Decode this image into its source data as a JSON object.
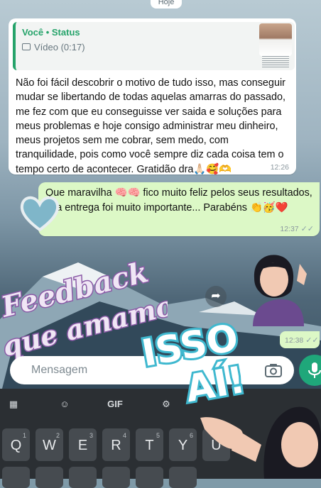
{
  "date_pill": "Hoje",
  "message_in": {
    "quote": {
      "title": "Você • Status",
      "subtitle": "Vídeo (0:17)"
    },
    "text": "Não foi fácil descobrir o motivo de tudo isso, mas conseguir mudar se libertando de todas aquelas amarras do passado, me fez com que eu conseguisse ver saida e soluções para meus problemas e hoje consigo administrar meu dinheiro, meus projetos sem me cobrar, sem medo, com tranquilidade, pois como você sempre diz cada coisa tem o tempo certo de acontecer. Gratidão dra🙏🏻🥰🫶",
    "time": "12:26"
  },
  "message_out": {
    "text": "Que maravilha 🧠🧠 fico muito feliz pelos seus resultados, sua entrega foi muito importante... Parabéns 👏🥳❤️",
    "time": "12:37",
    "status": "✓✓"
  },
  "message_out_sticker": {
    "time": "12:38",
    "status": "✓✓"
  },
  "stickers": {
    "feedback_line1": "Feedback",
    "feedback_line2": "que amamos",
    "isso_line1": "ISSO",
    "isso_line2": "AÍ!"
  },
  "input": {
    "placeholder": "Mensagem"
  },
  "keyboard": {
    "tools": [
      "grid",
      "sticker",
      "GIF",
      "settings"
    ],
    "row1": [
      {
        "key": "Q",
        "num": "1"
      },
      {
        "key": "W",
        "num": "2"
      },
      {
        "key": "E",
        "num": "3"
      },
      {
        "key": "R",
        "num": "4"
      },
      {
        "key": "T",
        "num": "5"
      },
      {
        "key": "Y",
        "num": "6"
      },
      {
        "key": "U",
        "num": "7"
      }
    ]
  },
  "colors": {
    "accent_green": "#25a36a",
    "out_bubble": "#dcf8c6",
    "mic_button": "#1fa77a",
    "keyboard_bg": "#2b2f33",
    "sticker_cyan": "#5fd0e0",
    "sticker_purple": "#c9a6d6"
  },
  "icons": {
    "forward": "forward-arrow-icon",
    "camera": "camera-icon",
    "mic": "microphone-icon",
    "heart": "heart-sticker-icon"
  }
}
